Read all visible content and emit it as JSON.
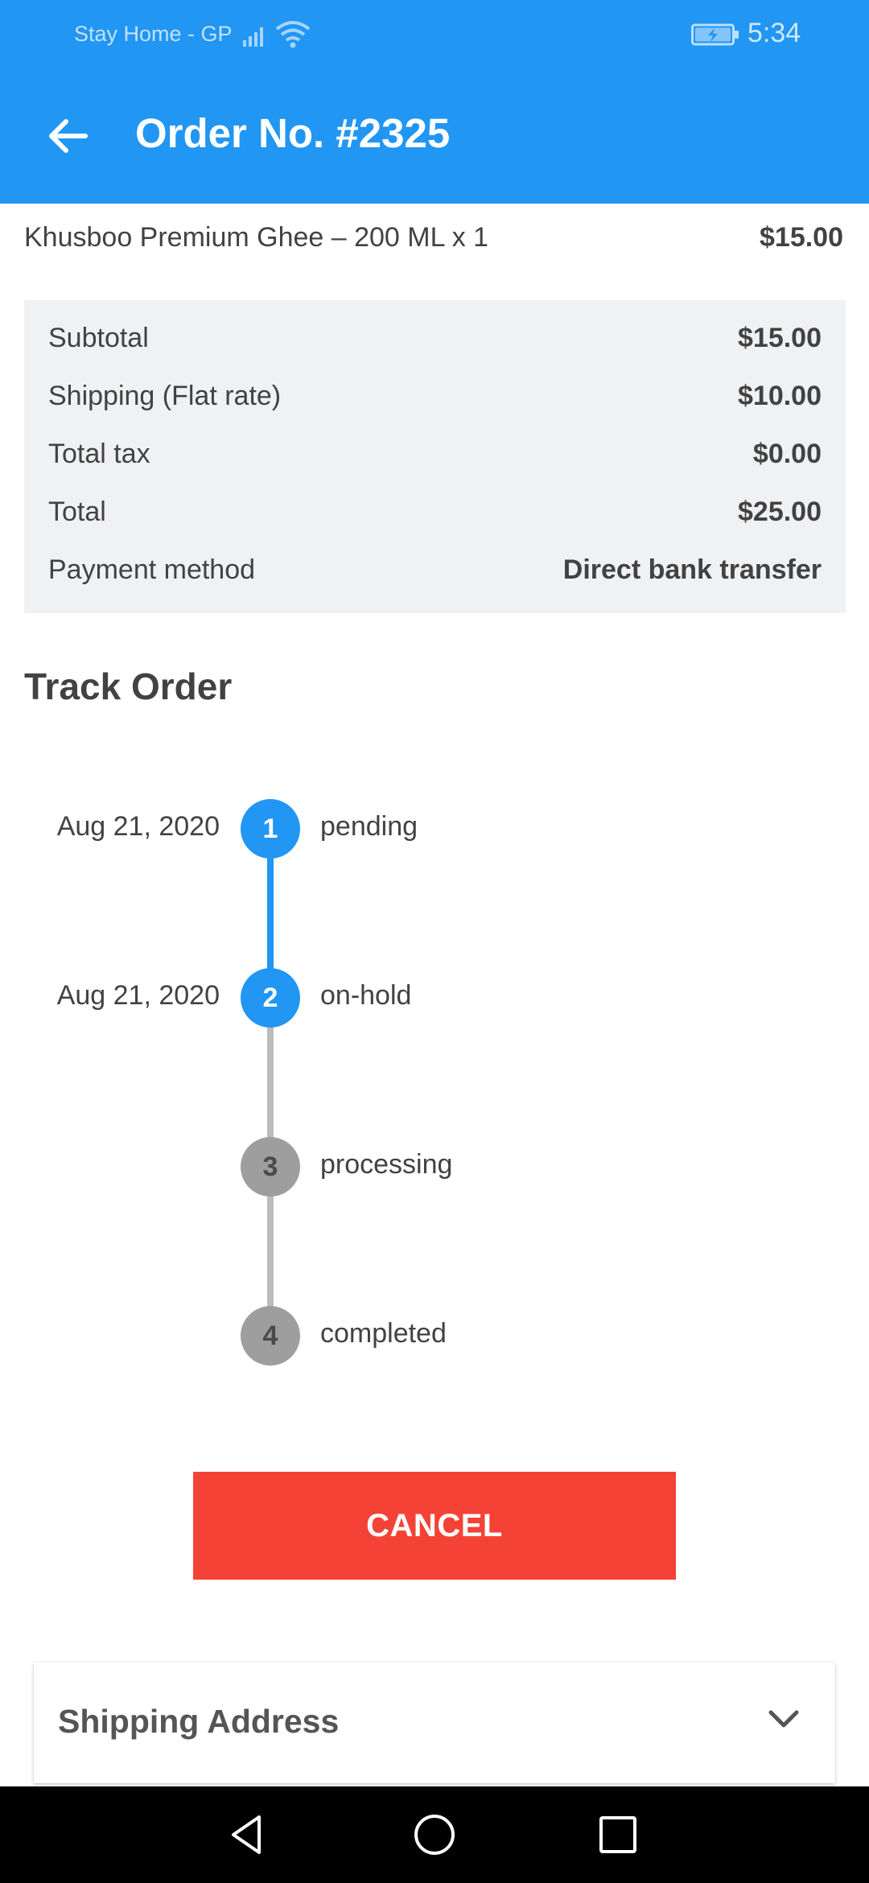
{
  "status_bar": {
    "carrier": "Stay Home - GP",
    "time": "5:34",
    "icons": [
      "signal-icon",
      "wifi-icon",
      "battery-charging-icon"
    ]
  },
  "toolbar": {
    "back_icon": "arrow-left-icon",
    "title": "Order No. #2325",
    "color": "#2196F3"
  },
  "line_item": {
    "name": "Khusboo Premium Ghee – 200 ML x 1",
    "price": "$15.00"
  },
  "summary": [
    {
      "label": "Subtotal",
      "value": "$15.00"
    },
    {
      "label": "Shipping (Flat rate)",
      "value": "$10.00"
    },
    {
      "label": "Total tax",
      "value": "$0.00"
    },
    {
      "label": "Total",
      "value": "$25.00"
    },
    {
      "label": "Payment method",
      "value": "Direct bank transfer"
    }
  ],
  "track": {
    "title": "Track Order",
    "steps": [
      {
        "number": "1",
        "label": "pending",
        "date": "Aug 21, 2020",
        "done": true
      },
      {
        "number": "2",
        "label": "on-hold",
        "date": "Aug 21, 2020",
        "done": true
      },
      {
        "number": "3",
        "label": "processing",
        "date": "",
        "done": false
      },
      {
        "number": "4",
        "label": "completed",
        "date": "",
        "done": false
      }
    ],
    "done_color": "#2196F3",
    "todo_color": "#9e9e9e"
  },
  "cancel_button": {
    "label": "CANCEL",
    "color": "#F44336"
  },
  "shipping_address": {
    "title": "Shipping Address",
    "icon": "chevron-down-icon"
  },
  "nav_bar": {
    "icons": [
      "nav-back-icon",
      "nav-home-icon",
      "nav-recents-icon"
    ]
  }
}
